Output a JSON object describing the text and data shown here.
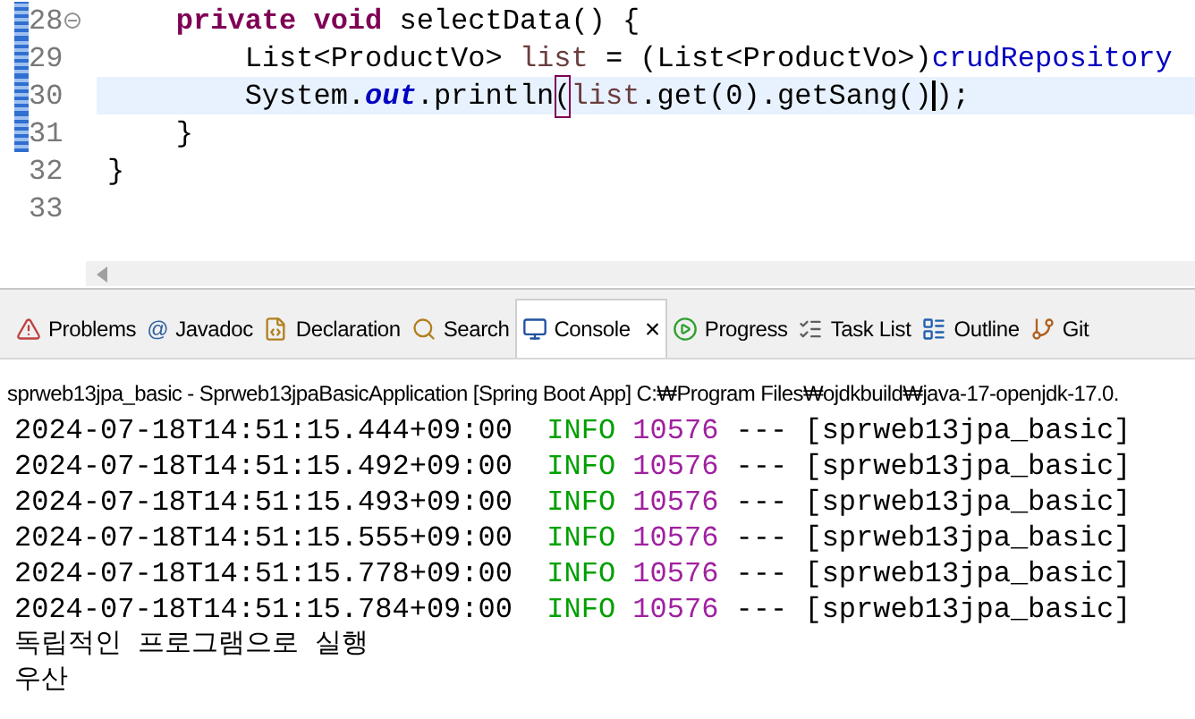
{
  "editor": {
    "lines": [
      {
        "number": "28",
        "changed": true,
        "folding": true,
        "current": false,
        "segments": [
          {
            "text": "    private void",
            "kind": "keyword"
          },
          {
            "text": " selectData() {",
            "kind": "plain"
          }
        ]
      },
      {
        "number": "29",
        "changed": true,
        "folding": false,
        "current": false,
        "segments": [
          {
            "text": "        List<ProductVo> ",
            "kind": "plain"
          },
          {
            "text": "list",
            "kind": "local"
          },
          {
            "text": " = (List<ProductVo>)",
            "kind": "plain"
          },
          {
            "text": "crudRepository",
            "kind": "member"
          }
        ]
      },
      {
        "number": "30",
        "changed": true,
        "folding": false,
        "current": true,
        "segments": [
          {
            "text": "        System.",
            "kind": "plain"
          },
          {
            "text": "out",
            "kind": "field"
          },
          {
            "text": ".println",
            "kind": "plain"
          },
          {
            "text": "(",
            "kind": "bracket"
          },
          {
            "text": "list",
            "kind": "local"
          },
          {
            "text": ".get(0).getSang()",
            "kind": "plain",
            "caret": true
          },
          {
            "text": ");",
            "kind": "plain"
          }
        ]
      },
      {
        "number": "31",
        "changed": true,
        "folding": false,
        "current": false,
        "segments": [
          {
            "text": "    }",
            "kind": "plain"
          }
        ]
      },
      {
        "number": "32",
        "changed": false,
        "folding": false,
        "current": false,
        "segments": [
          {
            "text": "}",
            "kind": "plain"
          }
        ]
      },
      {
        "number": "33",
        "changed": false,
        "folding": false,
        "current": false
      }
    ]
  },
  "tabs": [
    {
      "label": "Problems",
      "kind": "problems",
      "selected": false
    },
    {
      "label": "Javadoc",
      "kind": "javadoc",
      "glyph": "@",
      "selected": false
    },
    {
      "label": "Declaration",
      "kind": "declaration",
      "selected": false
    },
    {
      "label": "Search",
      "kind": "search",
      "selected": false
    },
    {
      "label": "Console",
      "kind": "console",
      "selected": true,
      "close": "×"
    },
    {
      "label": "Progress",
      "kind": "progress",
      "selected": false
    },
    {
      "label": "Task List",
      "kind": "tasks",
      "selected": false
    },
    {
      "label": "Outline",
      "kind": "outline",
      "selected": false
    },
    {
      "label": "Git",
      "kind": "git",
      "selected": false
    }
  ],
  "console": {
    "header": "sprweb13jpa_basic - Sprweb13jpaBasicApplication [Spring Boot App] C:₩Program Files₩ojdkbuild₩java-17-openjdk-17.0.",
    "log": [
      {
        "time": "2024-07-18T14:51:15.444+09:00",
        "level": "INFO",
        "pid": "10576",
        "sep": "---",
        "thread": "[sprweb13jpa_basic]"
      },
      {
        "time": "2024-07-18T14:51:15.492+09:00",
        "level": "INFO",
        "pid": "10576",
        "sep": "---",
        "thread": "[sprweb13jpa_basic]"
      },
      {
        "time": "2024-07-18T14:51:15.493+09:00",
        "level": "INFO",
        "pid": "10576",
        "sep": "---",
        "thread": "[sprweb13jpa_basic]"
      },
      {
        "time": "2024-07-18T14:51:15.555+09:00",
        "level": "INFO",
        "pid": "10576",
        "sep": "---",
        "thread": "[sprweb13jpa_basic]"
      },
      {
        "time": "2024-07-18T14:51:15.778+09:00",
        "level": "INFO",
        "pid": "10576",
        "sep": "---",
        "thread": "[sprweb13jpa_basic]"
      },
      {
        "time": "2024-07-18T14:51:15.784+09:00",
        "level": "INFO",
        "pid": "10576",
        "sep": "---",
        "thread": "[sprweb13jpa_basic]"
      }
    ],
    "output": [
      "독립적인 프로그램으로 실행",
      "우산"
    ]
  }
}
